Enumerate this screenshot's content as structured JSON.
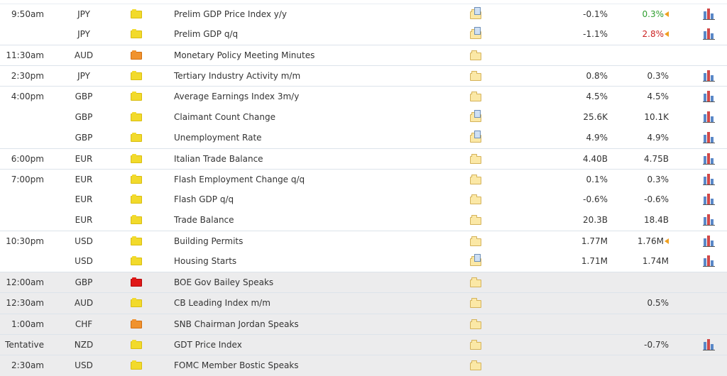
{
  "rows": [
    {
      "time": "9:50am",
      "currency": "JPY",
      "impact": "low",
      "event": "Prelim GDP Price Index y/y",
      "detail": "doc",
      "actual": "-0.1%",
      "forecast": "0.3%",
      "forecast_color": "green",
      "revised": true,
      "graph": true,
      "group_start": true,
      "shaded": false
    },
    {
      "time": "",
      "currency": "JPY",
      "impact": "low",
      "event": "Prelim GDP q/q",
      "detail": "doc",
      "actual": "-1.1%",
      "forecast": "2.8%",
      "forecast_color": "red",
      "revised": true,
      "graph": true,
      "group_start": false,
      "shaded": false
    },
    {
      "time": "11:30am",
      "currency": "AUD",
      "impact": "medium",
      "event": "Monetary Policy Meeting Minutes",
      "detail": "folder",
      "actual": "",
      "forecast": "",
      "forecast_color": "",
      "revised": false,
      "graph": false,
      "group_start": true,
      "shaded": false
    },
    {
      "time": "2:30pm",
      "currency": "JPY",
      "impact": "low",
      "event": "Tertiary Industry Activity m/m",
      "detail": "folder",
      "actual": "0.8%",
      "forecast": "0.3%",
      "forecast_color": "",
      "revised": false,
      "graph": true,
      "group_start": true,
      "shaded": false
    },
    {
      "time": "4:00pm",
      "currency": "GBP",
      "impact": "low",
      "event": "Average Earnings Index 3m/y",
      "detail": "folder",
      "actual": "4.5%",
      "forecast": "4.5%",
      "forecast_color": "",
      "revised": false,
      "graph": true,
      "group_start": true,
      "shaded": false
    },
    {
      "time": "",
      "currency": "GBP",
      "impact": "low",
      "event": "Claimant Count Change",
      "detail": "doc",
      "actual": "25.6K",
      "forecast": "10.1K",
      "forecast_color": "",
      "revised": false,
      "graph": true,
      "group_start": false,
      "shaded": false
    },
    {
      "time": "",
      "currency": "GBP",
      "impact": "low",
      "event": "Unemployment Rate",
      "detail": "doc",
      "actual": "4.9%",
      "forecast": "4.9%",
      "forecast_color": "",
      "revised": false,
      "graph": true,
      "group_start": false,
      "shaded": false
    },
    {
      "time": "6:00pm",
      "currency": "EUR",
      "impact": "low",
      "event": "Italian Trade Balance",
      "detail": "folder",
      "actual": "4.40B",
      "forecast": "4.75B",
      "forecast_color": "",
      "revised": false,
      "graph": true,
      "group_start": true,
      "shaded": false
    },
    {
      "time": "7:00pm",
      "currency": "EUR",
      "impact": "low",
      "event": "Flash Employment Change q/q",
      "detail": "folder",
      "actual": "0.1%",
      "forecast": "0.3%",
      "forecast_color": "",
      "revised": false,
      "graph": true,
      "group_start": true,
      "shaded": false
    },
    {
      "time": "",
      "currency": "EUR",
      "impact": "low",
      "event": "Flash GDP q/q",
      "detail": "folder",
      "actual": "-0.6%",
      "forecast": "-0.6%",
      "forecast_color": "",
      "revised": false,
      "graph": true,
      "group_start": false,
      "shaded": false
    },
    {
      "time": "",
      "currency": "EUR",
      "impact": "low",
      "event": "Trade Balance",
      "detail": "folder",
      "actual": "20.3B",
      "forecast": "18.4B",
      "forecast_color": "",
      "revised": false,
      "graph": true,
      "group_start": false,
      "shaded": false
    },
    {
      "time": "10:30pm",
      "currency": "USD",
      "impact": "low",
      "event": "Building Permits",
      "detail": "folder",
      "actual": "1.77M",
      "forecast": "1.76M",
      "forecast_color": "",
      "revised": true,
      "graph": true,
      "group_start": true,
      "shaded": false
    },
    {
      "time": "",
      "currency": "USD",
      "impact": "low",
      "event": "Housing Starts",
      "detail": "doc",
      "actual": "1.71M",
      "forecast": "1.74M",
      "forecast_color": "",
      "revised": false,
      "graph": true,
      "group_start": false,
      "shaded": false
    },
    {
      "time": "12:00am",
      "currency": "GBP",
      "impact": "high",
      "event": "BOE Gov Bailey Speaks",
      "detail": "folder",
      "actual": "",
      "forecast": "",
      "forecast_color": "",
      "revised": false,
      "graph": false,
      "group_start": true,
      "shaded": true
    },
    {
      "time": "12:30am",
      "currency": "AUD",
      "impact": "low",
      "event": "CB Leading Index m/m",
      "detail": "folder",
      "actual": "",
      "forecast": "0.5%",
      "forecast_color": "",
      "revised": false,
      "graph": false,
      "group_start": true,
      "shaded": true
    },
    {
      "time": "1:00am",
      "currency": "CHF",
      "impact": "medium",
      "event": "SNB Chairman Jordan Speaks",
      "detail": "folder",
      "actual": "",
      "forecast": "",
      "forecast_color": "",
      "revised": false,
      "graph": false,
      "group_start": true,
      "shaded": true
    },
    {
      "time": "Tentative",
      "currency": "NZD",
      "impact": "low",
      "event": "GDT Price Index",
      "detail": "folder",
      "actual": "",
      "forecast": "-0.7%",
      "forecast_color": "",
      "revised": false,
      "graph": true,
      "group_start": true,
      "shaded": true
    },
    {
      "time": "2:30am",
      "currency": "USD",
      "impact": "low",
      "event": "FOMC Member Bostic Speaks",
      "detail": "folder",
      "actual": "",
      "forecast": "",
      "forecast_color": "",
      "revised": false,
      "graph": false,
      "group_start": true,
      "shaded": true
    }
  ]
}
